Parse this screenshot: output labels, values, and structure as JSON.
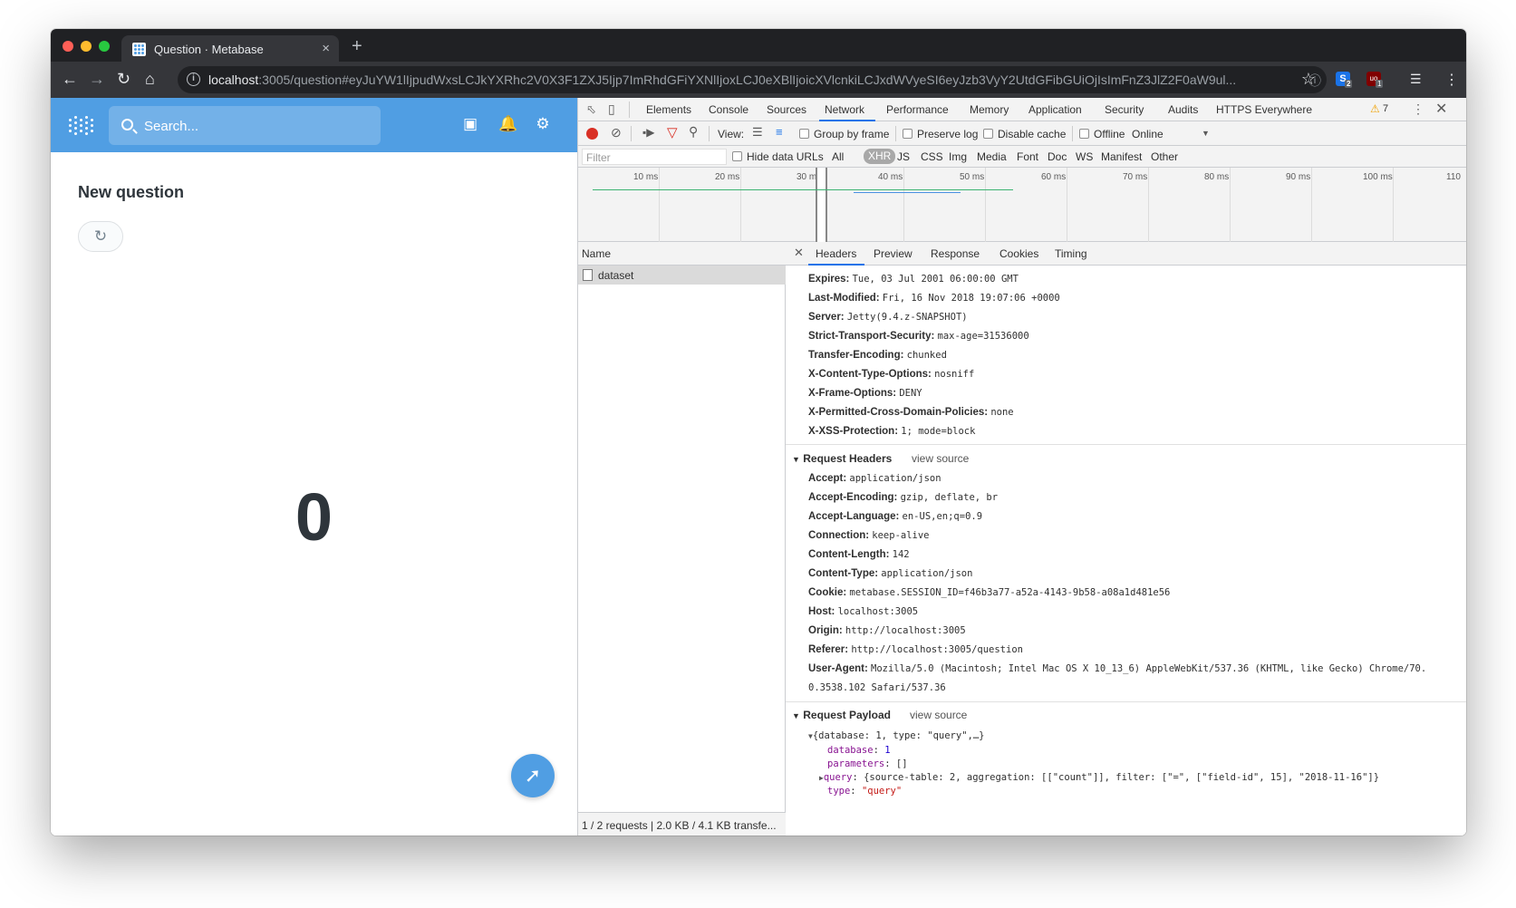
{
  "browser": {
    "tab_title": "Question · Metabase",
    "tab_close": "×",
    "new_tab": "+",
    "url_host": "localhost",
    "url_rest": ":3005/question#eyJuYW1lIjpudWxsLCJkYXRhc2V0X3F1ZXJ5Ijp7ImRhdGFiYXNlIjoxLCJ0eXBlIjoicXVlcnkiLCJxdWVyeSI6eyJzb3VyY2UtdGFibGUiOjIsImFnZ3JlZ2F0aW9ul...",
    "ext1_badge": "2",
    "ext2_badge": "1"
  },
  "app": {
    "search_placeholder": "Search...",
    "page_title": "New question",
    "scalar_value": "0"
  },
  "devtools": {
    "tabs": [
      "Elements",
      "Console",
      "Sources",
      "Network",
      "Performance",
      "Memory",
      "Application",
      "Security",
      "Audits",
      "HTTPS Everywhere"
    ],
    "active_tab": "Network",
    "warning_count": "7",
    "view_label": "View:",
    "group_by_frame": "Group by frame",
    "preserve_log": "Preserve log",
    "disable_cache": "Disable cache",
    "offline": "Offline",
    "throttle": "Online",
    "filter_placeholder": "Filter",
    "hide_data_urls": "Hide data URLs",
    "type_filters": [
      "All",
      "XHR",
      "JS",
      "CSS",
      "Img",
      "Media",
      "Font",
      "Doc",
      "WS",
      "Manifest",
      "Other"
    ],
    "active_type": "XHR",
    "timeline_labels": [
      "10 ms",
      "20 ms",
      "30 ms",
      "40 ms",
      "50 ms",
      "60 ms",
      "70 ms",
      "80 ms",
      "90 ms",
      "100 ms",
      "110"
    ],
    "name_header": "Name",
    "request_name": "dataset",
    "status_bar": "1 / 2 requests | 2.0 KB / 4.1 KB transfe...",
    "detail_tabs": [
      "Headers",
      "Preview",
      "Response",
      "Cookies",
      "Timing"
    ],
    "active_detail_tab": "Headers",
    "response_headers": [
      {
        "k": "Expires:",
        "v": "Tue, 03 Jul 2001 06:00:00 GMT"
      },
      {
        "k": "Last-Modified:",
        "v": "Fri, 16 Nov 2018 19:07:06 +0000"
      },
      {
        "k": "Server:",
        "v": "Jetty(9.4.z-SNAPSHOT)"
      },
      {
        "k": "Strict-Transport-Security:",
        "v": "max-age=31536000"
      },
      {
        "k": "Transfer-Encoding:",
        "v": "chunked"
      },
      {
        "k": "X-Content-Type-Options:",
        "v": "nosniff"
      },
      {
        "k": "X-Frame-Options:",
        "v": "DENY"
      },
      {
        "k": "X-Permitted-Cross-Domain-Policies:",
        "v": "none"
      },
      {
        "k": "X-XSS-Protection:",
        "v": "1; mode=block"
      }
    ],
    "request_headers_title": "Request Headers",
    "view_source": "view source",
    "request_headers": [
      {
        "k": "Accept:",
        "v": "application/json"
      },
      {
        "k": "Accept-Encoding:",
        "v": "gzip, deflate, br"
      },
      {
        "k": "Accept-Language:",
        "v": "en-US,en;q=0.9"
      },
      {
        "k": "Connection:",
        "v": "keep-alive"
      },
      {
        "k": "Content-Length:",
        "v": "142"
      },
      {
        "k": "Content-Type:",
        "v": "application/json"
      },
      {
        "k": "Cookie:",
        "v": "metabase.SESSION_ID=f46b3a77-a52a-4143-9b58-a08a1d481e56"
      },
      {
        "k": "Host:",
        "v": "localhost:3005"
      },
      {
        "k": "Origin:",
        "v": "http://localhost:3005"
      },
      {
        "k": "Referer:",
        "v": "http://localhost:3005/question"
      },
      {
        "k": "User-Agent:",
        "v": "Mozilla/5.0 (Macintosh; Intel Mac OS X 10_13_6) AppleWebKit/537.36 (KHTML, like Gecko) Chrome/70."
      }
    ],
    "user_agent_cont": "0.3538.102 Safari/537.36",
    "payload_title": "Request Payload",
    "payload_summary": "{database: 1, type: \"query\",…}",
    "payload_database_key": "database",
    "payload_database_val": "1",
    "payload_parameters_key": "parameters",
    "payload_parameters_val": "[]",
    "payload_query_key": "query",
    "payload_query_val": "{source-table: 2, aggregation: [[\"count\"]], filter: [\"=\", [\"field-id\", 15], \"2018-11-16\"]}",
    "payload_type_key": "type",
    "payload_type_val": "\"query\""
  },
  "colors": {
    "metabase_brand": "#509ee3",
    "devtools_accent": "#1a73e8",
    "record_red": "#d93025"
  }
}
